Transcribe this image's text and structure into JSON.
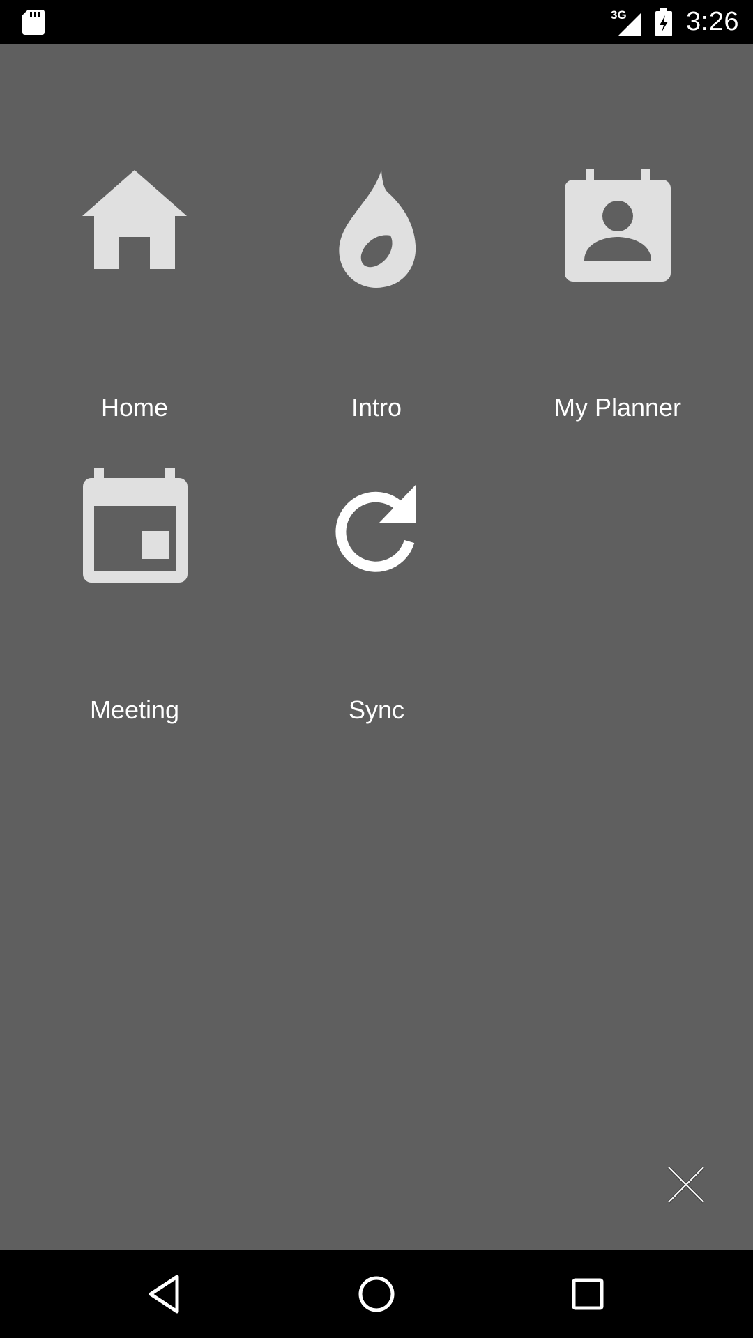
{
  "status_bar": {
    "network_type": "3G",
    "time": "3:26",
    "icons": [
      "sd-card-icon",
      "signal-icon",
      "battery-charging-icon"
    ]
  },
  "menu": {
    "items": [
      {
        "label": "Home",
        "icon": "home-icon"
      },
      {
        "label": "Intro",
        "icon": "flame-icon"
      },
      {
        "label": "My Planner",
        "icon": "contact-calendar-icon"
      },
      {
        "label": "Meeting",
        "icon": "event-calendar-icon"
      },
      {
        "label": "Sync",
        "icon": "sync-icon"
      }
    ],
    "close_icon": "close-icon"
  },
  "nav_bar": {
    "icons": [
      "back-icon",
      "home-circle-icon",
      "recents-icon"
    ]
  },
  "colors": {
    "background": "#5f5f5f",
    "icon": "#e0e0e0",
    "label": "#ffffff",
    "system_bars": "#000000"
  }
}
